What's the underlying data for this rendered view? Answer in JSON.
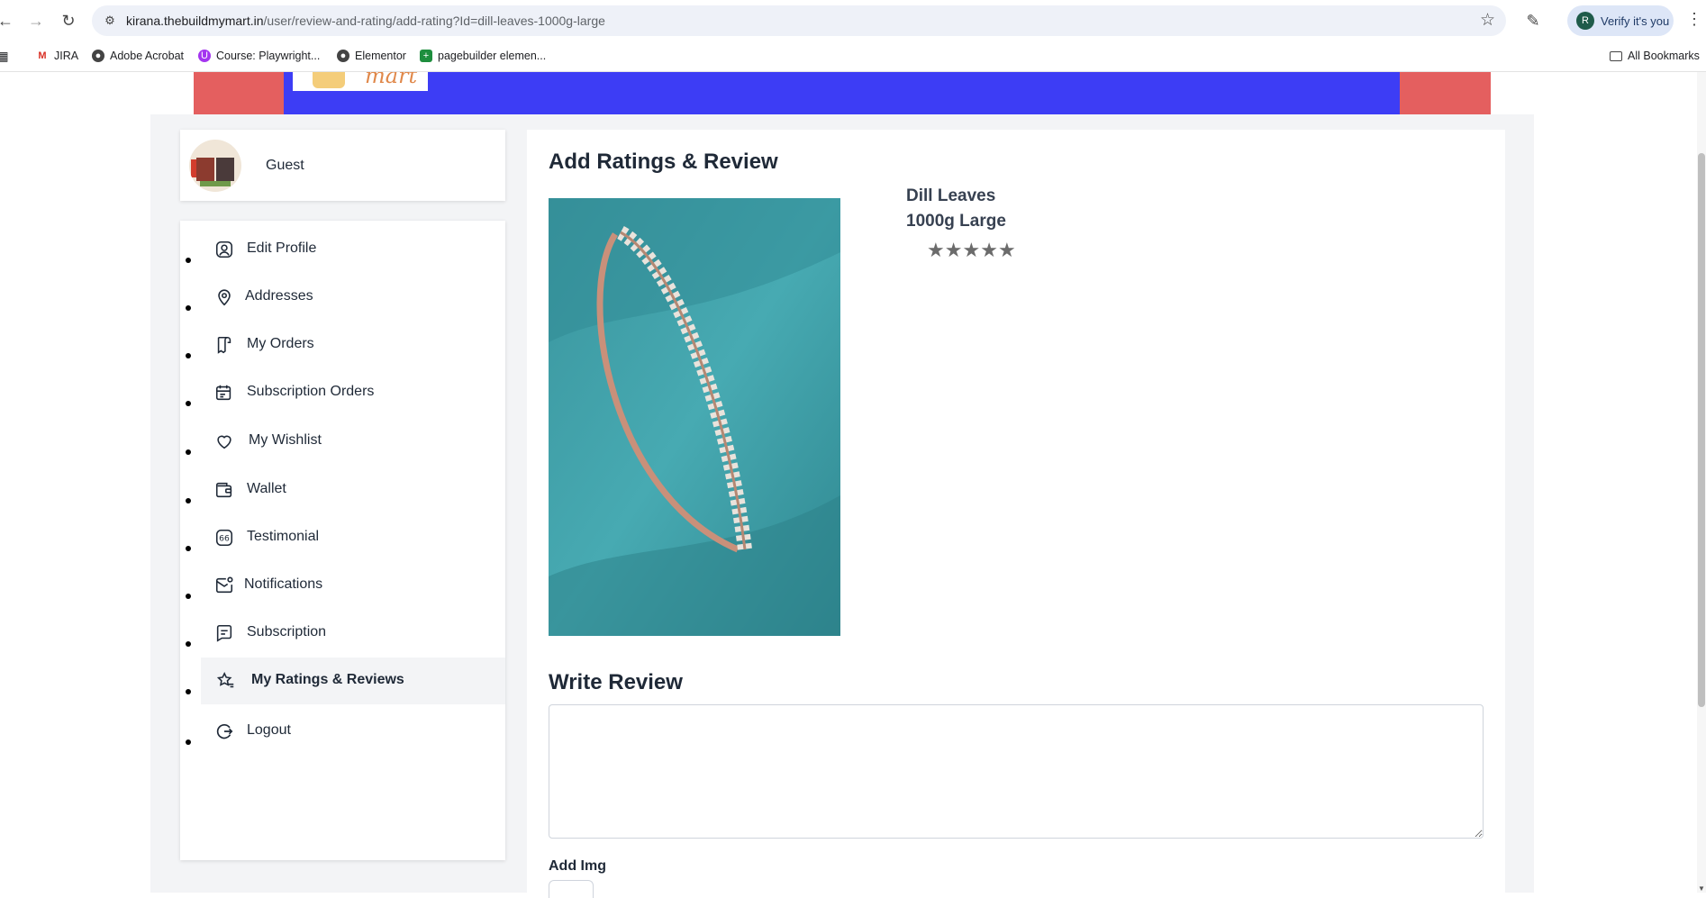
{
  "browser": {
    "url_host": "kirana.thebuildmymart.in",
    "url_path": "/user/review-and-rating/add-rating?Id=dill-leaves-1000g-large",
    "verify_label": "Verify it's you",
    "profile_initial": "R",
    "bookmarks": [
      "JIRA",
      "Adobe Acrobat",
      "Course: Playwright...",
      "Elementor",
      "pagebuilder elemen..."
    ],
    "all_bookmarks_label": "All Bookmarks"
  },
  "header": {
    "logo_text": "mart",
    "colors": {
      "outer": "#e45f5f",
      "inner": "#3d3df5"
    }
  },
  "profile": {
    "name": "Guest"
  },
  "sidebar": {
    "items": [
      {
        "label": "Edit Profile",
        "icon": "user-square-icon"
      },
      {
        "label": "Addresses",
        "icon": "map-pin-icon"
      },
      {
        "label": "My Orders",
        "icon": "orders-icon"
      },
      {
        "label": "Subscription Orders",
        "icon": "calendar-orders-icon"
      },
      {
        "label": "My Wishlist",
        "icon": "heart-icon"
      },
      {
        "label": "Wallet",
        "icon": "wallet-icon"
      },
      {
        "label": "Testimonial",
        "icon": "quote-icon"
      },
      {
        "label": "Notifications",
        "icon": "mail-notification-icon"
      },
      {
        "label": "Subscription",
        "icon": "message-icon"
      },
      {
        "label": "My Ratings & Reviews",
        "icon": "star-list-icon",
        "active": true
      },
      {
        "label": "Logout",
        "icon": "logout-icon"
      }
    ]
  },
  "main": {
    "title": "Add Ratings & Review",
    "product": {
      "name": "Dill Leaves",
      "variant": "1000g Large",
      "rating": 0,
      "max_rating": 5,
      "star_glyph": "★"
    },
    "review": {
      "heading": "Write Review",
      "value": "",
      "placeholder": ""
    },
    "add_img_label": "Add Img"
  }
}
